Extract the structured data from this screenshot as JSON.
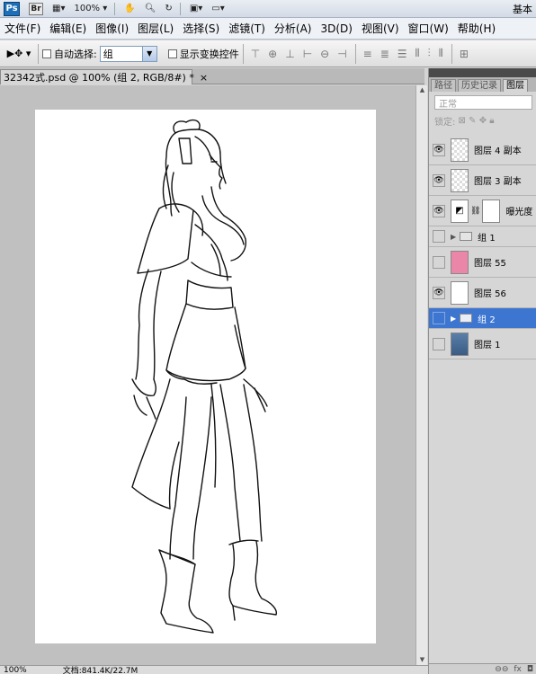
{
  "appbar": {
    "ps_logo": "Ps",
    "br_logo": "Br",
    "zoom": "100%",
    "workspace": "基本"
  },
  "menubar": {
    "items": [
      "文件(F)",
      "编辑(E)",
      "图像(I)",
      "图层(L)",
      "选择(S)",
      "滤镜(T)",
      "分析(A)",
      "3D(D)",
      "视图(V)",
      "窗口(W)",
      "帮助(H)"
    ]
  },
  "options": {
    "auto_select_label": "自动选择:",
    "auto_select_value": "组",
    "show_transform_label": "显示变换控件"
  },
  "document": {
    "tab_title": "32342式.psd @ 100% (组 2, RGB/8#) *",
    "close_glyph": "×"
  },
  "status": {
    "zoom": "100%",
    "doc_info": "文档:841.4K/22.7M"
  },
  "panel": {
    "tabs": [
      "路径",
      "历史记录",
      "图层"
    ],
    "blend_mode": "正常",
    "lock_label": "锁定:",
    "layers": [
      {
        "name": "图层 4 副本",
        "visible": true,
        "kind": "checker"
      },
      {
        "name": "图层 3 副本",
        "visible": true,
        "kind": "checker"
      },
      {
        "name": "曝光度",
        "visible": true,
        "kind": "adjust"
      },
      {
        "name": "组 1",
        "visible": false,
        "kind": "group"
      },
      {
        "name": "图层 55",
        "visible": false,
        "kind": "pink"
      },
      {
        "name": "图层 56",
        "visible": true,
        "kind": "white"
      },
      {
        "name": "组 2",
        "visible": false,
        "kind": "group",
        "selected": true
      },
      {
        "name": "图层 1",
        "visible": false,
        "kind": "blueimg"
      }
    ]
  },
  "colors": {
    "selection": "#3d76d1",
    "pink_swatch": "#ea86a8"
  }
}
